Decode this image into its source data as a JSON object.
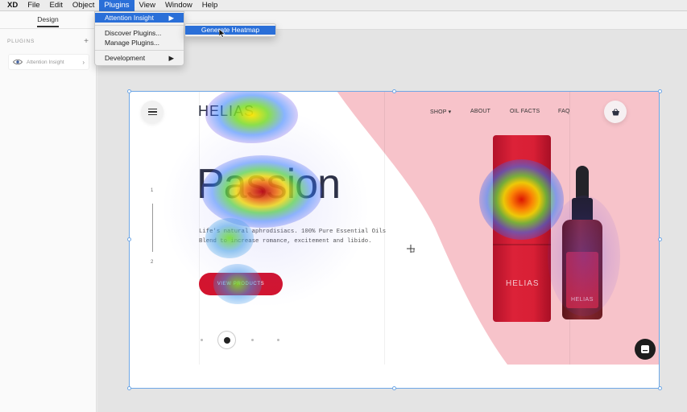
{
  "menubar": {
    "app": "XD",
    "items": [
      "File",
      "Edit",
      "Object",
      "Plugins",
      "View",
      "Window",
      "Help"
    ],
    "active": "Plugins"
  },
  "left_panel": {
    "tab": "Design",
    "section_title": "PLUGINS",
    "add_symbol": "+",
    "plugin_item": "Attention Insight",
    "chevron": "›"
  },
  "plugins_menu": {
    "items": [
      {
        "label": "Attention Insight",
        "submenu_arrow": "▶"
      },
      {
        "label": "Discover Plugins..."
      },
      {
        "label": "Manage Plugins..."
      },
      {
        "label": "Development",
        "submenu_arrow": "▶"
      }
    ],
    "submenu_item": "Generate Heatmap"
  },
  "artboard": {
    "brand": "HELIAS",
    "nav": [
      "SHOP ▾",
      "ABOUT",
      "OIL FACTS",
      "FAQ"
    ],
    "hero_title": "Passion",
    "hero_text": "Life's natural aphrodisiacs. 100% Pure Essential Oils Blend to increase romance, excitement and libido.",
    "cta": "VIEW PRODUCTS",
    "slide_top": "1",
    "slide_bottom": "2",
    "tube_label": "HELIAS",
    "bottle_label": "HELIAS"
  },
  "colors": {
    "accent_blue": "#2a6fd8",
    "pink_bg": "#f7c3ca",
    "cta_red": "#d3142e",
    "brand_dark": "#2d3142"
  }
}
